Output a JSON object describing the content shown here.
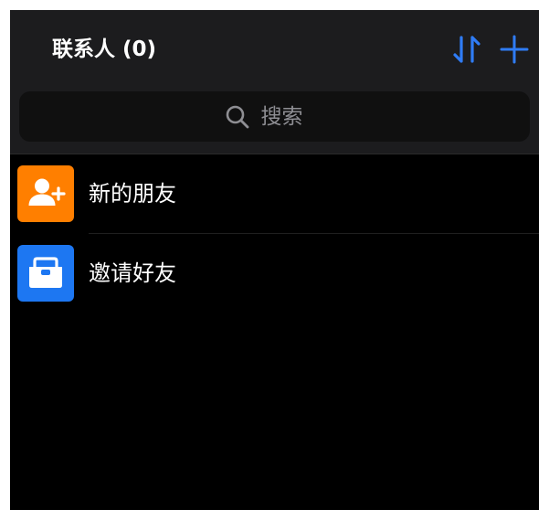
{
  "header": {
    "title": "联系人 (0)",
    "sort_icon": "sort-arrows-icon",
    "add_icon": "plus-icon"
  },
  "search": {
    "placeholder": "搜索",
    "icon": "search-icon"
  },
  "list": {
    "items": [
      {
        "label": "新的朋友",
        "icon": "add-person-icon",
        "icon_bg": "#ff7f00"
      },
      {
        "label": "邀请好友",
        "icon": "invite-inbox-icon",
        "icon_bg": "#1d77f2"
      }
    ]
  },
  "colors": {
    "accent": "#2f7cf6",
    "header_bg": "#1c1c1e",
    "screen_bg": "#000000"
  }
}
